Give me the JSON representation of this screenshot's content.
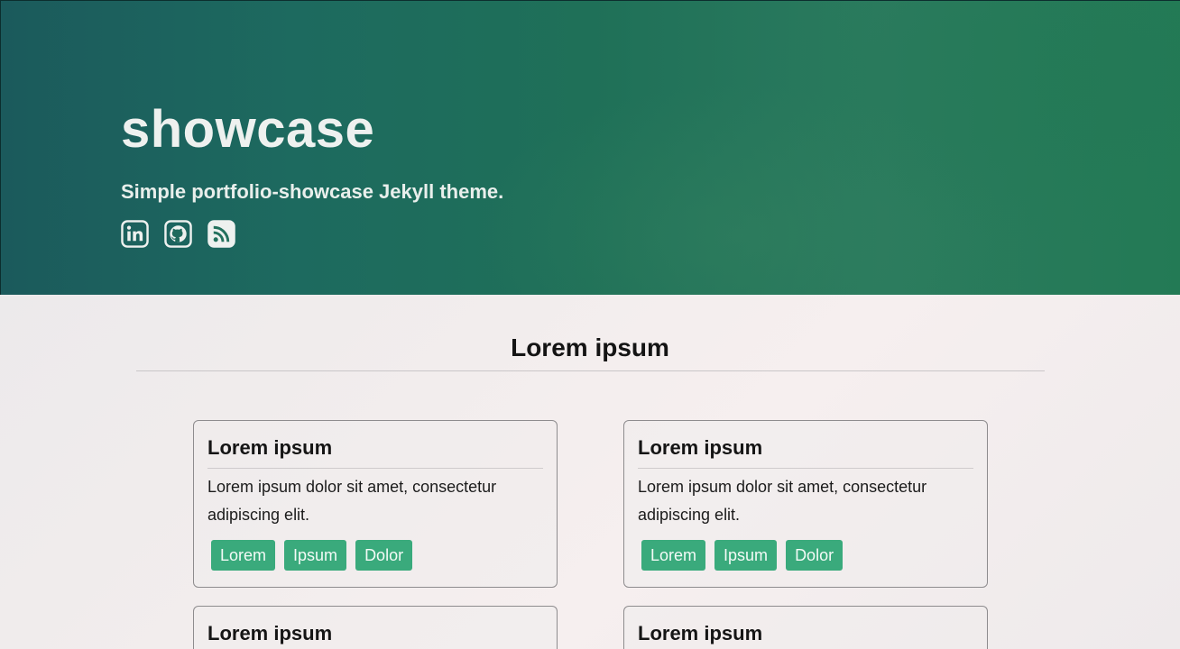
{
  "header": {
    "title": "showcase",
    "subtitle": "Simple portfolio-showcase Jekyll theme.",
    "social": [
      {
        "name": "linkedin-icon"
      },
      {
        "name": "github-icon"
      },
      {
        "name": "rss-icon"
      }
    ]
  },
  "section": {
    "title": "Lorem ipsum"
  },
  "cards": [
    {
      "title": "Lorem ipsum",
      "description": "Lorem ipsum dolor sit amet, consectetur adipiscing elit.",
      "tags": [
        "Lorem",
        "Ipsum",
        "Dolor"
      ]
    },
    {
      "title": "Lorem ipsum",
      "description": "Lorem ipsum dolor sit amet, consectetur adipiscing elit.",
      "tags": [
        "Lorem",
        "Ipsum",
        "Dolor"
      ]
    },
    {
      "title": "Lorem ipsum"
    },
    {
      "title": "Lorem ipsum"
    }
  ],
  "colors": {
    "hero_start": "#1b5a5c",
    "hero_end": "#237a55",
    "tag_bg": "#3aaa7c",
    "text_light": "#eef1ef"
  }
}
